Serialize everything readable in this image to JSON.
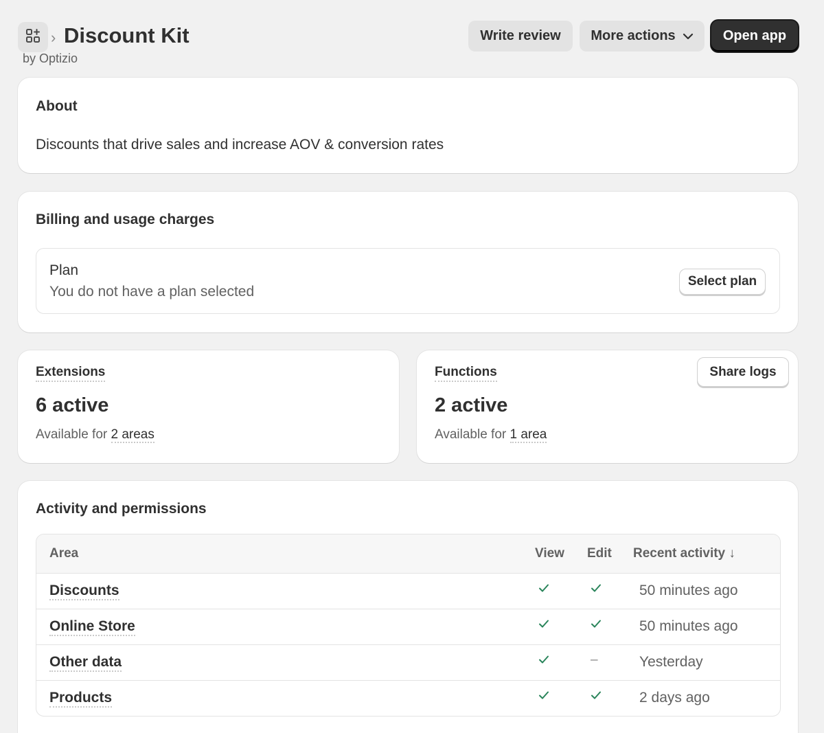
{
  "header": {
    "app_name": "Discount Kit",
    "by_line": "by Optizio",
    "write_review": "Write review",
    "more_actions": "More actions",
    "open_app": "Open app"
  },
  "about": {
    "title": "About",
    "description": "Discounts that drive sales and increase AOV & conversion rates"
  },
  "billing": {
    "title": "Billing and usage charges",
    "plan_label": "Plan",
    "plan_status": "You do not have a plan selected",
    "select_plan": "Select plan"
  },
  "extensions": {
    "title": "Extensions",
    "value": "6 active",
    "available_prefix": "Available for",
    "available_link": "2 areas"
  },
  "functions": {
    "title": "Functions",
    "value": "2 active",
    "available_prefix": "Available for",
    "available_link": "1 area",
    "share_logs": "Share logs"
  },
  "activity": {
    "title": "Activity and permissions",
    "columns": {
      "area": "Area",
      "view": "View",
      "edit": "Edit",
      "recent": "Recent activity ↓"
    },
    "rows": [
      {
        "area": "Discounts",
        "view": true,
        "edit": true,
        "recent": "50 minutes ago"
      },
      {
        "area": "Online Store",
        "view": true,
        "edit": true,
        "recent": "50 minutes ago"
      },
      {
        "area": "Other data",
        "view": true,
        "edit": false,
        "recent": "Yesterday"
      },
      {
        "area": "Products",
        "view": true,
        "edit": true,
        "recent": "2 days ago"
      }
    ],
    "no_edit_symbol": "–"
  },
  "colors": {
    "check": "#29845a",
    "primary_button": "#303030",
    "page_bg": "#f1f1f1"
  }
}
